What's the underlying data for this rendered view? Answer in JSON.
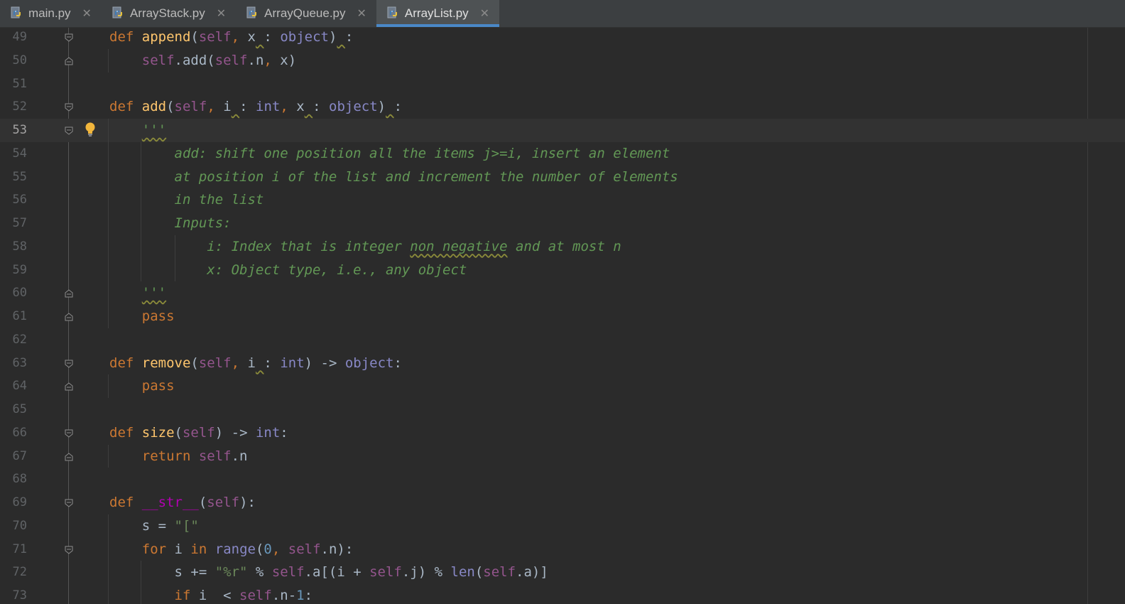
{
  "tabs": [
    {
      "label": "main.py",
      "active": false
    },
    {
      "label": "ArrayStack.py",
      "active": false
    },
    {
      "label": "ArrayQueue.py",
      "active": false
    },
    {
      "label": "ArrayList.py",
      "active": true
    }
  ],
  "lines": [
    {
      "num": "49",
      "segments": [
        [
          "kw",
          "def "
        ],
        [
          "fn",
          "append"
        ],
        [
          "",
          "("
        ],
        [
          "sf",
          "self"
        ],
        [
          "kw",
          ", "
        ],
        [
          "",
          "x"
        ],
        [
          "sq",
          " "
        ],
        [
          "",
          ": "
        ],
        [
          "bi",
          "object"
        ],
        [
          "",
          ")"
        ],
        [
          "sq",
          " "
        ],
        [
          "",
          ":"
        ]
      ]
    },
    {
      "num": "50",
      "segments": [
        [
          "",
          "    "
        ],
        [
          "sf",
          "self"
        ],
        [
          "",
          ".add("
        ],
        [
          "sf",
          "self"
        ],
        [
          "",
          ".n"
        ],
        [
          "kw",
          ", "
        ],
        [
          "",
          "x)"
        ]
      ]
    },
    {
      "num": "51",
      "segments": []
    },
    {
      "num": "52",
      "segments": [
        [
          "kw",
          "def "
        ],
        [
          "fn",
          "add"
        ],
        [
          "",
          "("
        ],
        [
          "sf",
          "self"
        ],
        [
          "kw",
          ", "
        ],
        [
          "",
          "i"
        ],
        [
          "sq",
          " "
        ],
        [
          "",
          ": "
        ],
        [
          "bi",
          "int"
        ],
        [
          "kw",
          ", "
        ],
        [
          "",
          "x"
        ],
        [
          "sq",
          " "
        ],
        [
          "",
          ": "
        ],
        [
          "bi",
          "object"
        ],
        [
          "",
          ")"
        ],
        [
          "sq",
          " "
        ],
        [
          "",
          ":"
        ]
      ]
    },
    {
      "num": "53",
      "segments": [
        [
          "",
          "    "
        ],
        [
          "doc sq",
          "'''"
        ]
      ]
    },
    {
      "num": "54",
      "segments": [
        [
          "",
          "        "
        ],
        [
          "doc",
          "add: shift one position all the items j>=i, insert an element"
        ]
      ]
    },
    {
      "num": "55",
      "segments": [
        [
          "",
          "        "
        ],
        [
          "doc",
          "at position i of the list and increment the number of elements"
        ]
      ]
    },
    {
      "num": "56",
      "segments": [
        [
          "",
          "        "
        ],
        [
          "doc",
          "in the list"
        ]
      ]
    },
    {
      "num": "57",
      "segments": [
        [
          "",
          "        "
        ],
        [
          "doc",
          "Inputs:"
        ]
      ]
    },
    {
      "num": "58",
      "segments": [
        [
          "",
          "            "
        ],
        [
          "doc",
          "i: Index that is integer "
        ],
        [
          "doc sq",
          "non negative"
        ],
        [
          "doc",
          " and at most n"
        ]
      ]
    },
    {
      "num": "59",
      "segments": [
        [
          "",
          "            "
        ],
        [
          "doc",
          "x: Object type, i.e., any object"
        ]
      ]
    },
    {
      "num": "60",
      "segments": [
        [
          "",
          "    "
        ],
        [
          "doc sq",
          "'''"
        ]
      ]
    },
    {
      "num": "61",
      "segments": [
        [
          "",
          "    "
        ],
        [
          "kw",
          "pass"
        ]
      ]
    },
    {
      "num": "62",
      "segments": []
    },
    {
      "num": "63",
      "segments": [
        [
          "kw",
          "def "
        ],
        [
          "fn",
          "remove"
        ],
        [
          "",
          "("
        ],
        [
          "sf",
          "self"
        ],
        [
          "kw",
          ", "
        ],
        [
          "",
          "i"
        ],
        [
          "sq",
          " "
        ],
        [
          "",
          ": "
        ],
        [
          "bi",
          "int"
        ],
        [
          "",
          ") -> "
        ],
        [
          "bi",
          "object"
        ],
        [
          "",
          ":"
        ]
      ]
    },
    {
      "num": "64",
      "segments": [
        [
          "",
          "    "
        ],
        [
          "kw",
          "pass"
        ]
      ]
    },
    {
      "num": "65",
      "segments": []
    },
    {
      "num": "66",
      "segments": [
        [
          "kw",
          "def "
        ],
        [
          "fn",
          "size"
        ],
        [
          "",
          "("
        ],
        [
          "sf",
          "self"
        ],
        [
          "",
          ") -> "
        ],
        [
          "bi",
          "int"
        ],
        [
          "",
          ":"
        ]
      ]
    },
    {
      "num": "67",
      "segments": [
        [
          "",
          "    "
        ],
        [
          "kw",
          "return "
        ],
        [
          "sf",
          "self"
        ],
        [
          "",
          ".n"
        ]
      ]
    },
    {
      "num": "68",
      "segments": []
    },
    {
      "num": "69",
      "segments": [
        [
          "kw",
          "def "
        ],
        [
          "mg",
          "__str__"
        ],
        [
          "",
          "("
        ],
        [
          "sf",
          "self"
        ],
        [
          "",
          "):"
        ]
      ]
    },
    {
      "num": "70",
      "segments": [
        [
          "",
          "    s = "
        ],
        [
          "st",
          "\"[\""
        ]
      ]
    },
    {
      "num": "71",
      "segments": [
        [
          "",
          "    "
        ],
        [
          "kw",
          "for "
        ],
        [
          "",
          "i "
        ],
        [
          "kw",
          "in "
        ],
        [
          "bi",
          "range"
        ],
        [
          "",
          "("
        ],
        [
          "num",
          "0"
        ],
        [
          "kw",
          ", "
        ],
        [
          "sf",
          "self"
        ],
        [
          "",
          ".n):"
        ]
      ]
    },
    {
      "num": "72",
      "segments": [
        [
          "",
          "        s += "
        ],
        [
          "st",
          "\"%r\""
        ],
        [
          "",
          " % "
        ],
        [
          "sf",
          "self"
        ],
        [
          "",
          ".a[(i + "
        ],
        [
          "sf",
          "self"
        ],
        [
          "",
          ".j) % "
        ],
        [
          "bi",
          "len"
        ],
        [
          "",
          "("
        ],
        [
          "sf",
          "self"
        ],
        [
          "",
          ".a)]"
        ]
      ]
    },
    {
      "num": "73",
      "segments": [
        [
          "",
          "        "
        ],
        [
          "kw",
          "if "
        ],
        [
          "",
          "i  < "
        ],
        [
          "sf",
          "self"
        ],
        [
          "",
          ".n-"
        ],
        [
          "num",
          "1"
        ],
        [
          "",
          ":"
        ]
      ]
    }
  ]
}
